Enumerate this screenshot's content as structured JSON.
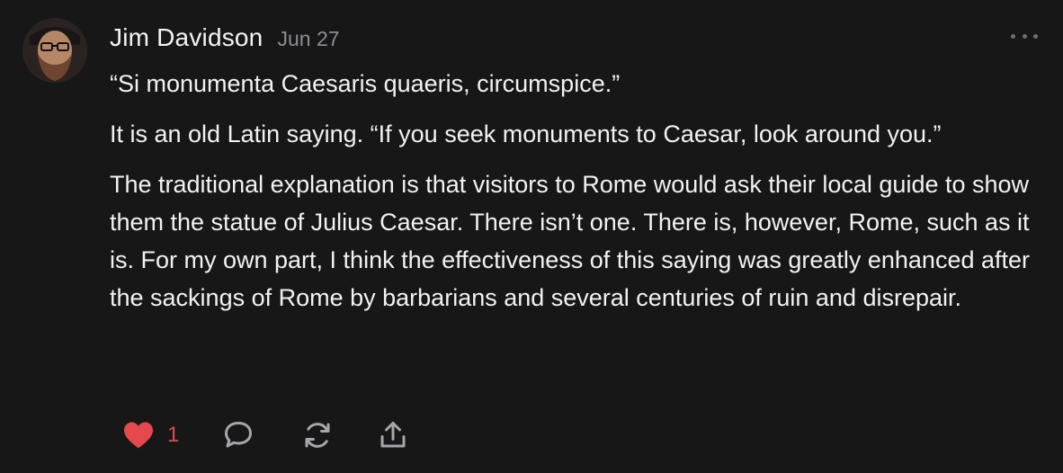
{
  "post": {
    "author": "Jim Davidson",
    "date": "Jun 27",
    "paragraphs": [
      "“Si monumenta Caesaris quaeris, circumspice.”",
      "It is an old Latin saying. “If you seek monuments to Caesar, look around you.”",
      "The traditional explanation is that visitors to Rome would ask their local guide to show them the statue of Julius Caesar. There isn’t one. There is, however, Rome, such as it is. For my own part, I think the effectiveness of this saying was greatly enhanced after the sackings of Rome by barbarians and several centuries of ruin and disrepair."
    ],
    "like_count": "1"
  },
  "icons": {
    "avatar": "user-avatar",
    "more": "more-horizontal-icon",
    "like": "heart-icon",
    "comment": "comment-icon",
    "restack": "restack-icon",
    "share": "share-icon"
  },
  "colors": {
    "background": "#171718",
    "like_red": "#e5484d",
    "muted": "#8d8d92"
  }
}
